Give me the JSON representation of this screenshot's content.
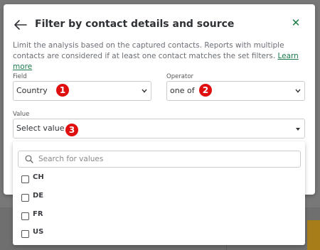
{
  "dialog": {
    "title": "Filter by contact details and source",
    "description": "Limit the analysis based on the captured contacts. Reports with multiple contacts are considered if at least one contact matches the set filters.",
    "learn_more": "Learn more"
  },
  "field": {
    "label": "Field",
    "value": "Country",
    "step": "1"
  },
  "operator": {
    "label": "Operator",
    "value": "one of",
    "step": "2"
  },
  "value": {
    "label": "Value",
    "placeholder": "Select value",
    "step": "3"
  },
  "dropdown": {
    "search_placeholder": "Search for values",
    "options": [
      "CH",
      "DE",
      "FR",
      "US"
    ]
  },
  "colors": {
    "accent": "#1a7a4a",
    "badge": "#e00f0f"
  }
}
